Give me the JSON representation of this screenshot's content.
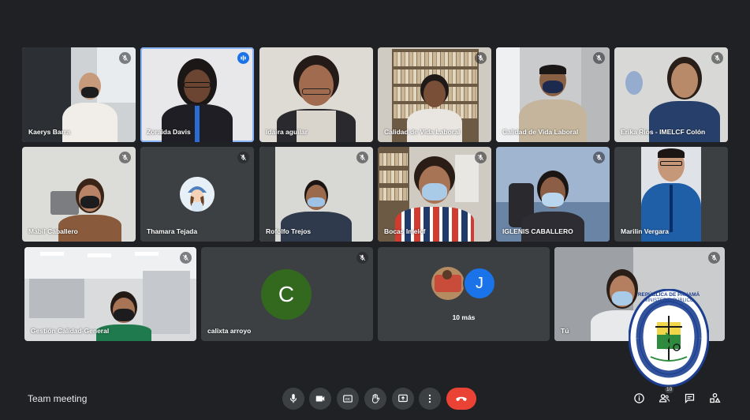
{
  "meeting": {
    "title": "Team meeting"
  },
  "participants": [
    {
      "name": "Kaerys Barra"
    },
    {
      "name": "Zoraida Davis"
    },
    {
      "name": "Idaira aguilar"
    },
    {
      "name": "Calidad de Vida Laboral"
    },
    {
      "name": "Calidad de Vida Laboral"
    },
    {
      "name": "Erika Rios - IMELCF Colón"
    },
    {
      "name": "Mabil Caballero"
    },
    {
      "name": "Thamara Tejada"
    },
    {
      "name": "Rofolfo Trejos"
    },
    {
      "name": "Bocas Imelcf"
    },
    {
      "name": "IGLENIS CABALLERO"
    },
    {
      "name": "Marilin Vergara"
    },
    {
      "name": "Gestión Calidad-General"
    },
    {
      "name": "calixta arroyo",
      "initial": "C",
      "color": "#33691e"
    },
    {
      "name": "Tú"
    }
  ],
  "others": {
    "label": "10 más",
    "initial": "J",
    "color": "#1a73e8"
  },
  "logo": {
    "top_line": "REPÚBLICA DE PANAMÁ",
    "second_line": "MINISTERIO PÚBLICO",
    "ring_text": "INSTITUTO DE MEDICINA LEGAL Y CIENCIAS FORENSES"
  },
  "people_count": "10",
  "icons": {
    "mic": "mic-icon",
    "camera": "camera-icon",
    "captions": "captions-icon",
    "hand": "raise-hand-icon",
    "present": "present-icon",
    "more": "more-vert-icon",
    "hangup": "hang-up-icon",
    "info": "info-icon",
    "people": "people-icon",
    "chat": "chat-icon",
    "activities": "activities-icon"
  },
  "colors": {
    "background": "#202124",
    "tile": "#3c4043",
    "hangup": "#ea4335",
    "active": "#8ab4f8"
  }
}
